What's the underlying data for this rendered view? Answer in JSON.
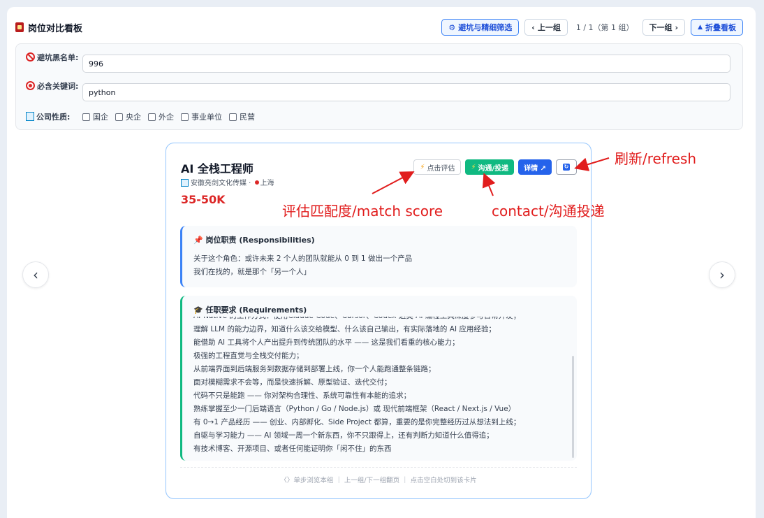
{
  "header": {
    "title": "岗位对比看板",
    "filter_btn": "避坑与精细筛选",
    "prev_btn": "上一组",
    "pager": "1 / 1（第 1 组）",
    "next_btn": "下一组",
    "collapse_btn": "折叠看板"
  },
  "filters": {
    "blacklist_label": "避坑黑名单:",
    "blacklist_value": "996",
    "keyword_label": "必含关键词:",
    "keyword_value": "python",
    "company_label": "公司性质:",
    "company_options": [
      "国企",
      "央企",
      "外企",
      "事业单位",
      "民营"
    ]
  },
  "card": {
    "title": "AI 全栈工程师",
    "company": "安徽亮剑文化传媒",
    "location": "上海",
    "salary": "35-50K",
    "eval_btn": "点击评估",
    "contact_btn": "沟通/投递",
    "detail_btn": "详情 ↗",
    "responsibilities_title": "岗位职责 (Responsibilities)",
    "responsibilities": [
      "关于这个角色：或许未来 2 个人的团队就能从 0 到 1 做出一个产品",
      "我们在找的，就是那个「另一个人」"
    ],
    "requirements_title": "任职要求 (Requirements)",
    "requirements": [
      "AI-Native 的工作方式：使用Claude Code、Cursor、Codex 这类 AI 编程工具深度参与日常开发；",
      "理解 LLM 的能力边界，知道什么该交给模型、什么该自己输出，有实际落地的 AI 应用经验；",
      "能借助 AI 工具将个人产出提升到传统团队的水平 —— 这是我们看重的核心能力；",
      "极强的工程直觉与全栈交付能力；",
      "从前端界面到后端服务到数据存储到部署上线，你一个人能跑通整条链路；",
      "面对模糊需求不会等，而是快速拆解、原型验证、迭代交付；",
      "代码不只是能跑 —— 你对架构合理性、系统可靠性有本能的追求；",
      "熟练掌握至少一门后端语言（Python / Go / Node.js）或 现代前端框架（React / Next.js / Vue）",
      "有 0→1 产品经历 —— 创业、内部孵化、Side Project 都算，重要的是你完整经历过从想法到上线；",
      "自驱与学习能力 —— AI 领域一周一个新东西，你不只跟得上，还有判断力知道什么值得追；",
      "有技术博客、开源项目、或者任何能证明你「闲不住」的东西"
    ],
    "hint": "〈〉单步浏览本组 ｜ 上一组/下一组翻页 ｜ 点击空白处切到该卡片"
  },
  "annotations": {
    "refresh": "刷新/refresh",
    "match": "评估匹配度/match score",
    "contact": "contact/沟通投递"
  },
  "colors": {
    "accent": "#2563eb",
    "contact": "#10b981",
    "salary": "#dc2626",
    "annotation": "#e11d1d"
  }
}
